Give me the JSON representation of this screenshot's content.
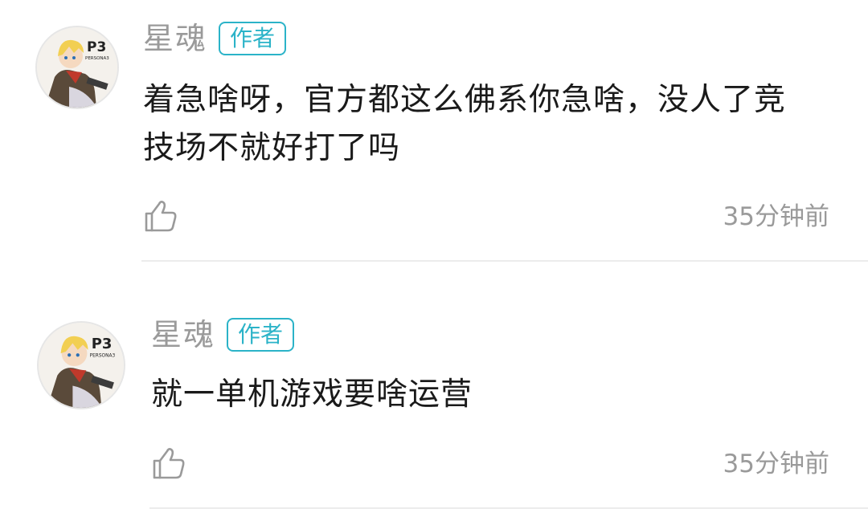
{
  "comments": [
    {
      "author": "星魂",
      "badge": "作者",
      "avatar_icon": "persona3-character-avatar",
      "avatar_logo_text": "P3",
      "avatar_logo_subtext": "PERSONA3",
      "text_lines": [
        "着急啥呀，官方都这么佛系你急啥，没人了竞",
        "技场不就好打了吗"
      ],
      "like_icon": "thumbs-up-icon",
      "time": "35分钟前"
    },
    {
      "author": "星魂",
      "badge": "作者",
      "avatar_icon": "persona3-character-avatar",
      "avatar_logo_text": "P3",
      "avatar_logo_subtext": "PERSONA3",
      "text_lines": [
        "就一单机游戏要啥运营"
      ],
      "like_icon": "thumbs-up-icon",
      "time": "35分钟前"
    }
  ],
  "colors": {
    "badge": "#2bb3c8",
    "meta_text": "#9a9a9a",
    "body_text": "#1a1a1a",
    "divider": "#ececec"
  }
}
